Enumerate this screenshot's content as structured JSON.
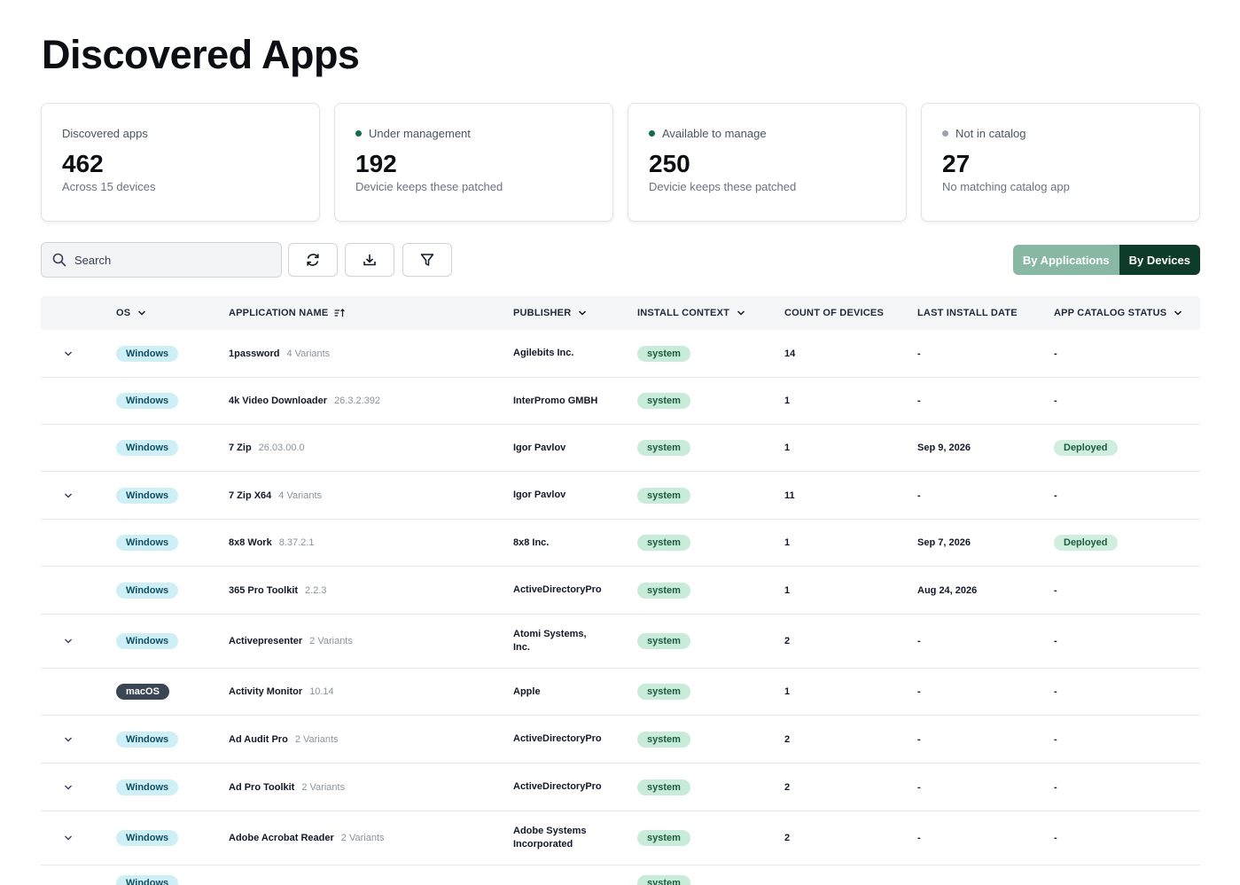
{
  "page": {
    "title": "Discovered Apps"
  },
  "stats": [
    {
      "label": "Discovered apps",
      "value": "462",
      "sub": "Across 15 devices",
      "dot": ""
    },
    {
      "label": "Under management",
      "value": "192",
      "sub": "Devicie keeps these patched",
      "dot": "#0f6b4a"
    },
    {
      "label": "Available to manage",
      "value": "250",
      "sub": "Devicie keeps these patched",
      "dot": "#0f6b4a"
    },
    {
      "label": "Not in catalog",
      "value": "27",
      "sub": "No matching catalog app",
      "dot": "#9ca3af"
    }
  ],
  "toolbar": {
    "search_placeholder": "Search",
    "icons": [
      "search-icon",
      "refresh-icon",
      "download-icon",
      "filter-icon"
    ],
    "view_toggle": {
      "by_applications": "By Applications",
      "by_devices": "By Devices",
      "selected": "By Devices"
    }
  },
  "table": {
    "columns": {
      "os": "OS",
      "app_name": "APPLICATION NAME",
      "publisher": "PUBLISHER",
      "install_context": "INSTALL CONTEXT",
      "count": "COUNT OF DEVICES",
      "last_install": "LAST INSTALL DATE",
      "catalog_status": "APP CATALOG STATUS"
    },
    "rows": [
      {
        "expandable": true,
        "os": "Windows",
        "name": "1password",
        "meta": "4 Variants",
        "publisher": "Agilebits Inc.",
        "context": "system",
        "count": "14",
        "last": "-",
        "status": "-"
      },
      {
        "expandable": false,
        "os": "Windows",
        "name": "4k Video Downloader",
        "meta": "26.3.2.392",
        "publisher": "InterPromo GMBH",
        "context": "system",
        "count": "1",
        "last": "-",
        "status": "-"
      },
      {
        "expandable": false,
        "os": "Windows",
        "name": "7 Zip",
        "meta": "26.03.00.0",
        "publisher": "Igor Pavlov",
        "context": "system",
        "count": "1",
        "last": "Sep 9, 2026",
        "status": "Deployed"
      },
      {
        "expandable": true,
        "os": "Windows",
        "name": "7 Zip X64",
        "meta": "4 Variants",
        "publisher": "Igor Pavlov",
        "context": "system",
        "count": "11",
        "last": "-",
        "status": "-"
      },
      {
        "expandable": false,
        "os": "Windows",
        "name": "8x8 Work",
        "meta": "8.37.2.1",
        "publisher": "8x8 Inc.",
        "context": "system",
        "count": "1",
        "last": "Sep 7, 2026",
        "status": "Deployed"
      },
      {
        "expandable": false,
        "os": "Windows",
        "name": "365 Pro Toolkit",
        "meta": "2.2.3",
        "publisher": "ActiveDirectoryPro",
        "context": "system",
        "count": "1",
        "last": "Aug 24, 2026",
        "status": "-"
      },
      {
        "expandable": true,
        "os": "Windows",
        "name": "Activepresenter",
        "meta": "2 Variants",
        "publisher": "Atomi Systems, Inc.",
        "context": "system",
        "count": "2",
        "last": "-",
        "status": "-"
      },
      {
        "expandable": false,
        "os": "macOS",
        "name": "Activity Monitor",
        "meta": "10.14",
        "publisher": "Apple",
        "context": "system",
        "count": "1",
        "last": "-",
        "status": "-"
      },
      {
        "expandable": true,
        "os": "Windows",
        "name": "Ad Audit Pro",
        "meta": "2 Variants",
        "publisher": "ActiveDirectoryPro",
        "context": "system",
        "count": "2",
        "last": "-",
        "status": "-"
      },
      {
        "expandable": true,
        "os": "Windows",
        "name": "Ad Pro Toolkit",
        "meta": "2 Variants",
        "publisher": "ActiveDirectoryPro",
        "context": "system",
        "count": "2",
        "last": "-",
        "status": "-"
      },
      {
        "expandable": true,
        "os": "Windows",
        "name": "Adobe Acrobat Reader",
        "meta": "2 Variants",
        "publisher": "Adobe Systems Incorporated",
        "context": "system",
        "count": "2",
        "last": "-",
        "status": "-"
      },
      {
        "expandable": false,
        "os": "Windows",
        "name": "",
        "meta": "",
        "publisher": "",
        "context": "system",
        "count": "",
        "last": "",
        "status": ""
      }
    ]
  }
}
